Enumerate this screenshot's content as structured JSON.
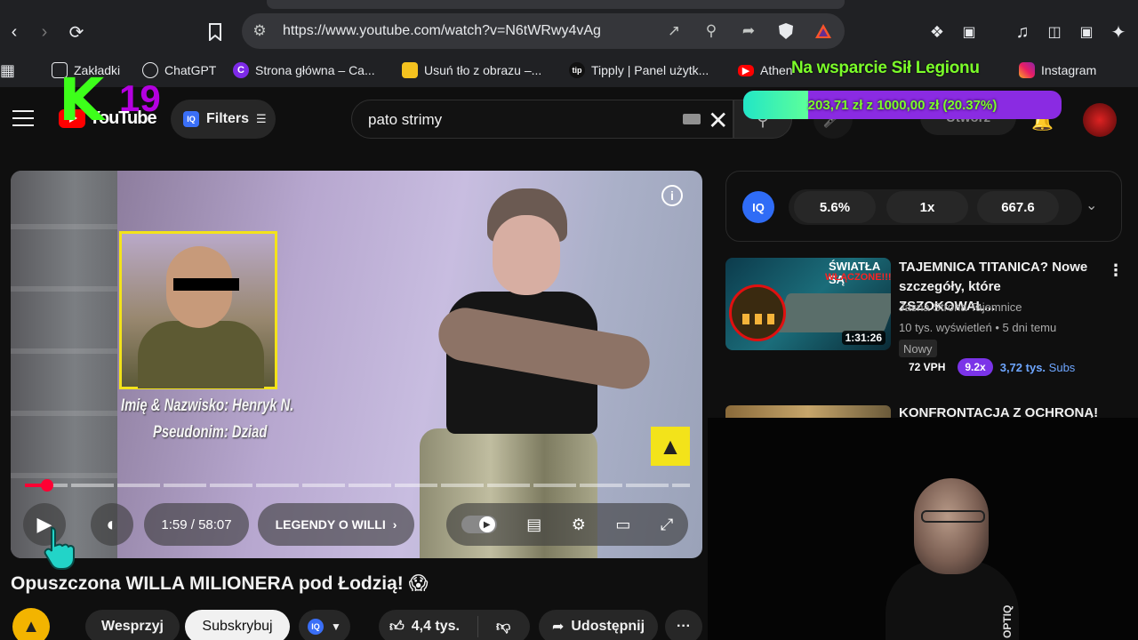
{
  "browser": {
    "url": "https://www.youtube.com/watch?v=N6tWRwy4vAg",
    "bookmarks": [
      {
        "label": "Zakładki",
        "icon": "bookmark-folder-icon"
      },
      {
        "label": "ChatGPT",
        "icon": "chatgpt-icon"
      },
      {
        "label": "Strona główna – Ca...",
        "icon": "canva-icon"
      },
      {
        "label": "Usuń tło z obrazu –...",
        "icon": "removebg-icon"
      },
      {
        "label": "Tipply | Panel użytk...",
        "icon": "tipply-icon"
      },
      {
        "label": "Athen",
        "icon": "youtube-icon"
      },
      {
        "label": "Instagram",
        "icon": "instagram-icon"
      }
    ]
  },
  "overlay": {
    "logo_k": "K",
    "logo_num": "19",
    "donation_title": "Na wsparcie Sił Legionu",
    "donation_label": "203,71 zł z 1000,00 zł (20.37%)",
    "donation_fraction": 0.2037,
    "donation_colors": {
      "fill": "#22e6c6",
      "rest": "#8a2be2",
      "text": "#7cff2a"
    }
  },
  "header": {
    "logo_text": "YouTube",
    "filters_label": "Filters",
    "search_value": "pato strimy",
    "create_label": "Utwórz"
  },
  "player": {
    "inset_caption_1": "Imię & Nazwisko: Henryk N.",
    "inset_caption_2": "Pseudonim: Dziad",
    "progress_fraction": 0.034,
    "time": "1:59 / 58:07",
    "chapter": "LEGENDY O WILLI"
  },
  "video": {
    "title": "Opuszczona WILLA MILIONERA pod Łodzią! 😱",
    "support_label": "Wesprzyj",
    "subscribe_label": "Subskrybuj",
    "likes": "4,4 tys.",
    "share_label": "Udostępnij",
    "more_label": "···"
  },
  "vidiq": {
    "logo": "IQ",
    "stats": [
      "5.6%",
      "1x",
      "667.6"
    ]
  },
  "recommendations": [
    {
      "title": "TAJEMNICA TITANICA? Nowe szczegóły, które ZSZOKOWAŁ...",
      "thumb_text_1": "ŚWIATŁA SĄ",
      "thumb_text_2": "WŁĄCZONE!!!",
      "duration": "1:31:26",
      "channel": "Jasna Strona Tajemnice",
      "meta": "10 tys. wyświetleń • 5 dni temu",
      "badge_new": "Nowy",
      "vph": "72 VPH",
      "multiplier": "9.2x",
      "subs_value": "3,72 tys.",
      "subs_label": "Subs"
    },
    {
      "title": "KONFRONTACJA Z OCHRONĄ!"
    }
  ],
  "webcam": {
    "mic_brand": "OPTIQ"
  }
}
